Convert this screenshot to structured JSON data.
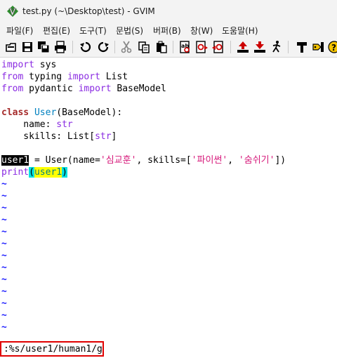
{
  "window": {
    "title": "test.py (~\\Desktop\\test) - GVIM",
    "app_icon": "gvim-icon"
  },
  "menu": [
    "파일(F)",
    "편집(E)",
    "도구(T)",
    "문법(S)",
    "버퍼(B)",
    "창(W)",
    "도움말(H)"
  ],
  "toolbar": {
    "icons": [
      "open-icon",
      "save-icon",
      "save-all-icon",
      "print-icon",
      "undo-icon",
      "redo-icon",
      "cut-icon",
      "copy-icon",
      "paste-icon",
      "replace-icon",
      "find-next-icon",
      "find-prev-icon",
      "load-session-icon",
      "save-session-icon",
      "run-script-icon",
      "make-icon",
      "run-ctags-icon",
      "help-icon"
    ]
  },
  "editor": {
    "lines": [
      {
        "parts": [
          {
            "t": "import",
            "c": "kw"
          },
          {
            "t": " sys",
            "c": ""
          }
        ]
      },
      {
        "parts": [
          {
            "t": "from",
            "c": "kw"
          },
          {
            "t": " typing ",
            "c": ""
          },
          {
            "t": "import",
            "c": "kw"
          },
          {
            "t": " List",
            "c": ""
          }
        ]
      },
      {
        "parts": [
          {
            "t": "from",
            "c": "kw"
          },
          {
            "t": " pydantic ",
            "c": ""
          },
          {
            "t": "import",
            "c": "kw"
          },
          {
            "t": " BaseModel",
            "c": ""
          }
        ]
      },
      {
        "parts": []
      },
      {
        "parts": [
          {
            "t": "class",
            "c": "kw2"
          },
          {
            "t": " ",
            "c": ""
          },
          {
            "t": "User",
            "c": "cls"
          },
          {
            "t": "(BaseModel):",
            "c": ""
          }
        ]
      },
      {
        "parts": [
          {
            "t": "    name: ",
            "c": ""
          },
          {
            "t": "str",
            "c": "bi"
          }
        ]
      },
      {
        "parts": [
          {
            "t": "    skills: List[",
            "c": ""
          },
          {
            "t": "str",
            "c": "bi"
          },
          {
            "t": "]",
            "c": ""
          }
        ]
      },
      {
        "parts": []
      },
      {
        "parts": [
          {
            "t": "user1",
            "c": "cursor-hl"
          },
          {
            "t": " = User(name=",
            "c": ""
          },
          {
            "t": "'심교훈'",
            "c": "str"
          },
          {
            "t": ", skills=[",
            "c": ""
          },
          {
            "t": "'파이썬'",
            "c": "str"
          },
          {
            "t": ", ",
            "c": ""
          },
          {
            "t": "'숨쉬기'",
            "c": "str"
          },
          {
            "t": "])",
            "c": ""
          }
        ]
      },
      {
        "parts": [
          {
            "t": "print",
            "c": "bi"
          },
          {
            "t": "(",
            "c": "paren-hl"
          },
          {
            "t": "user1",
            "c": "search-hl"
          },
          {
            "t": ")",
            "c": "paren-hl"
          }
        ]
      }
    ],
    "tilde_char": "~",
    "tilde_count": 13
  },
  "cmdline": {
    "text": ":%s/user1/human1/g"
  },
  "colors": {
    "keyword": "#8a2be2",
    "statement": "#a52a2a",
    "class_name": "#0080c0",
    "string": "#d6187a",
    "tilde": "#2020ff",
    "highlight_border": "#e00000"
  }
}
